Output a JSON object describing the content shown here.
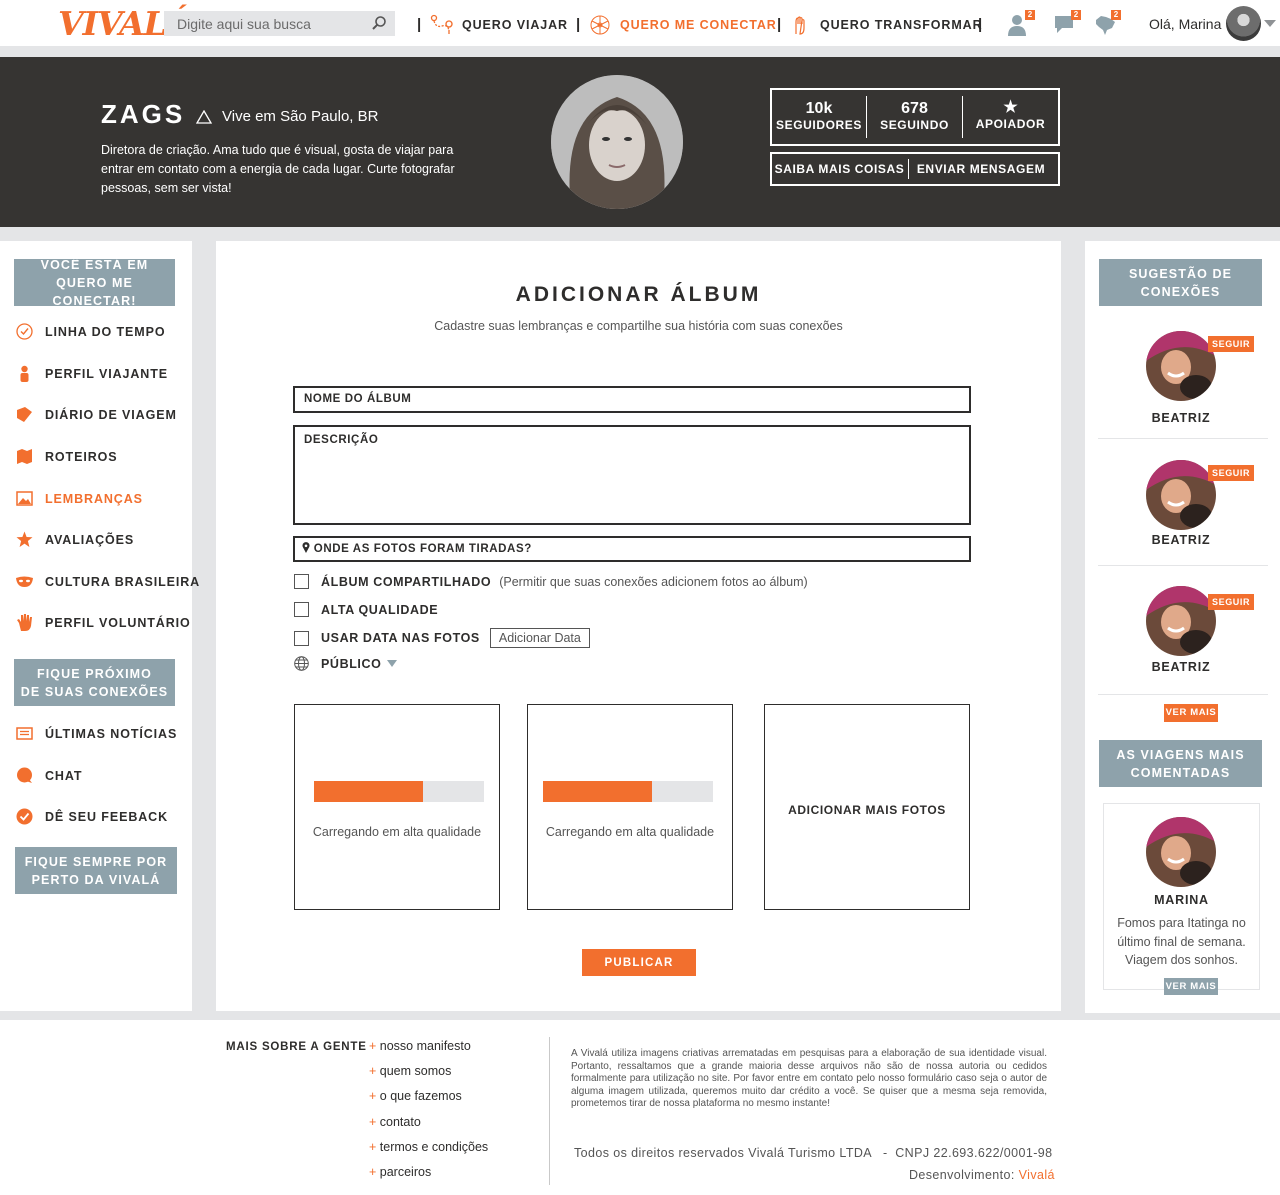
{
  "brand": {
    "logo": "VIVALÁ",
    "accent": "#f26f2e",
    "dark": "#363432",
    "gray_button": "#8ea2ab"
  },
  "search": {
    "placeholder": "Digite aqui sua busca",
    "icon": "search-icon"
  },
  "nav": {
    "items": [
      {
        "label": "QUERO VIAJAR",
        "icon": "route-icon",
        "active": false
      },
      {
        "label": "QUERO ME CONECTAR",
        "icon": "network-icon",
        "active": true
      },
      {
        "label": "QUERO TRANSFORMAR",
        "icon": "hand-icon",
        "active": false
      }
    ],
    "notifications": [
      {
        "icon": "user-icon",
        "count": "2"
      },
      {
        "icon": "chat-icon",
        "count": "2"
      },
      {
        "icon": "brazil-map-icon",
        "count": "2"
      }
    ],
    "greeting": "Olá, Marina"
  },
  "profile": {
    "name": "ZAGS",
    "location": "Vive em São Paulo, BR",
    "bio": "Diretora de criação. Ama tudo que é visual, gosta de viajar para entrar em contato com a energia de cada lugar. Curte fotografar pessoas, sem ser vista!",
    "stats": [
      {
        "value": "10k",
        "label": "SEGUIDORES"
      },
      {
        "value": "678",
        "label": "SEGUINDO"
      },
      {
        "value": "★",
        "label": "APOIADOR"
      }
    ],
    "actions": [
      "SAIBA MAIS COISAS",
      "ENVIAR MENSAGEM"
    ]
  },
  "left": {
    "context_box": "VOCÊ ESTÁ EM\nQUERO ME CONECTAR!",
    "menu": [
      {
        "label": "LINHA DO TEMPO",
        "icon": "clock-check-icon"
      },
      {
        "label": "PERFIL VIAJANTE",
        "icon": "person-icon"
      },
      {
        "label": "DIÁRIO DE VIAGEM",
        "icon": "book-icon"
      },
      {
        "label": "ROTEIROS",
        "icon": "map-icon"
      },
      {
        "label": "LEMBRANÇAS",
        "icon": "image-icon",
        "active": true
      },
      {
        "label": "AVALIAÇÕES",
        "icon": "star-icon"
      },
      {
        "label": "CULTURA BRASILEIRA",
        "icon": "mask-icon"
      },
      {
        "label": "PERFIL VOLUNTÁRIO",
        "icon": "hand-icon"
      }
    ],
    "section2": "FIQUE PRÓXIMO\nDE SUAS CONEXÕES",
    "menu2": [
      {
        "label": "ÚLTIMAS NOTÍCIAS",
        "icon": "newspaper-icon"
      },
      {
        "label": "CHAT",
        "icon": "chat-bubble-icon"
      },
      {
        "label": "DÊ SEU FEEBACK",
        "icon": "check-circle-icon"
      }
    ],
    "section3": "FIQUE SEMPRE POR\nPERTO DA VIVALÁ"
  },
  "form": {
    "title": "ADICIONAR ÁLBUM",
    "subtitle": "Cadastre suas lembranças e compartilhe sua história com suas conexões",
    "album_name": "NOME DO ÁLBUM",
    "description": "DESCRIÇÃO",
    "location": "ONDE AS FOTOS FORAM TIRADAS?",
    "shared_label": "ÁLBUM COMPARTILHADO",
    "shared_note": "(Permitir que suas conexões adicionem fotos ao álbum)",
    "hq_label": "ALTA QUALIDADE",
    "date_label": "USAR DATA NAS FOTOS",
    "add_date": "Adicionar Data",
    "privacy": "PÚBLICO",
    "uploads": [
      {
        "text": "Carregando em alta qualidade",
        "progress": 0.64
      },
      {
        "text": "Carregando em alta qualidade",
        "progress": 0.64
      }
    ],
    "add_more": "ADICIONAR MAIS FOTOS",
    "publish": "PUBLICAR"
  },
  "right": {
    "suggestions_title": "SUGESTÃO DE\nCONEXÕES",
    "suggestions": [
      {
        "name": "BEATRIZ",
        "follow": "SEGUIR"
      },
      {
        "name": "BEATRIZ",
        "follow": "SEGUIR"
      },
      {
        "name": "BEATRIZ",
        "follow": "SEGUIR"
      }
    ],
    "see_more": "VER MAIS",
    "trips_title": "AS VIAGENS MAIS\nCOMENTADAS",
    "trip": {
      "name": "MARINA",
      "text": "Fomos para Itatinga no último final de semana. Viagem dos sonhos."
    },
    "see_more2": "VER MAIS"
  },
  "footer": {
    "heading": "MAIS SOBRE A GENTE",
    "links": [
      "nosso manifesto",
      "quem somos",
      "o que fazemos",
      "contato",
      "termos e condições",
      "parceiros"
    ],
    "disclaimer": "A Vivalá utiliza imagens criativas arrematadas em pesquisas para a elaboração de sua identidade visual. Portanto, ressaltamos que a grande maioria desse arquivos não são de nossa autoria ou cedidos formalmente para utilização no site. Por favor entre em contato pelo nosso formulário caso seja o autor de alguma imagem utilizada, queremos muito dar crédito a você. Se quiser que a mesma seja removida, prometemos tirar de nossa plataforma no mesmo instante!",
    "rights": "Todos os direitos reservados Vivalá Turismo LTDA   -  CNPJ 22.693.622/0001-98",
    "dev_label": "Desenvolvimento:",
    "dev_name": "Vivalá"
  }
}
